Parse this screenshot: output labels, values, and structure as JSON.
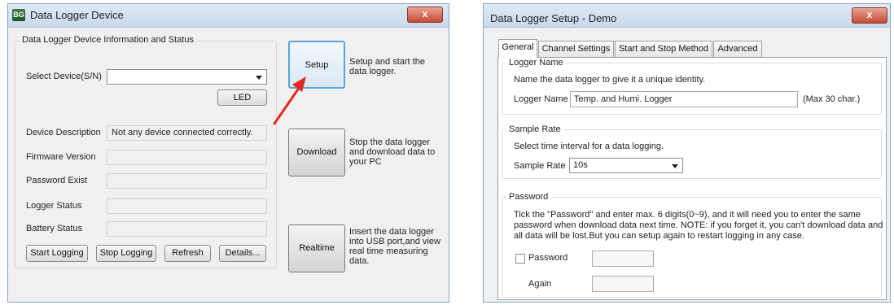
{
  "left_window": {
    "title": "Data Logger Device",
    "close_label": "x",
    "group_label": "Data Logger Device Information and Status",
    "select_device_label": "Select Device(S/N)",
    "select_device_value": "",
    "led_label": "LED",
    "device_description_label": "Device Description",
    "device_description_value": "Not any device connected correctly.",
    "firmware_label": "Firmware Version",
    "password_exist_label": "Password Exist",
    "logger_status_label": "Logger Status",
    "battery_status_label": "Battery Status",
    "start_logging_label": "Start Logging",
    "stop_logging_label": "Stop Logging",
    "refresh_label": "Refresh",
    "details_label": "Details...",
    "setup_label": "Setup",
    "setup_desc": [
      "Setup and start the",
      "data logger."
    ],
    "download_label": "Download",
    "download_desc": [
      "Stop the data logger",
      "and download data to",
      "your PC"
    ],
    "realtime_label": "Realtime",
    "realtime_desc": [
      "Insert the data logger",
      "into USB port,and view",
      "real time measuring",
      "data."
    ],
    "annotation_arrow_color": "#e02a1e"
  },
  "right_window": {
    "title": "Data Logger Setup - Demo",
    "close_label": "x",
    "tabs": [
      "General",
      "Channel Settings",
      "Start and Stop Method",
      "Advanced"
    ],
    "active_tab": "General",
    "logger_name_group": "Logger Name",
    "logger_name_hint": "Name the data logger to give it a unique identity.",
    "logger_name_label": "Logger Name",
    "logger_name_value": "Temp. and Humi. Logger",
    "logger_name_max": "(Max 30 char.)",
    "sample_rate_group": "Sample Rate",
    "sample_rate_hint": "Select time interval for a data logging.",
    "sample_rate_label": "Sample Rate",
    "sample_rate_value": "10s",
    "password_group": "Password",
    "password_text": [
      "Tick the \"Password\" and enter max. 6 digits(0~9), and it will need you to enter the same",
      "password when download data next time. NOTE: if you forget it, you can't download data and",
      "all data will be lost.But you can setup again to restart logging in any case."
    ],
    "password_checkbox_label": "Password",
    "again_label": "Again"
  }
}
